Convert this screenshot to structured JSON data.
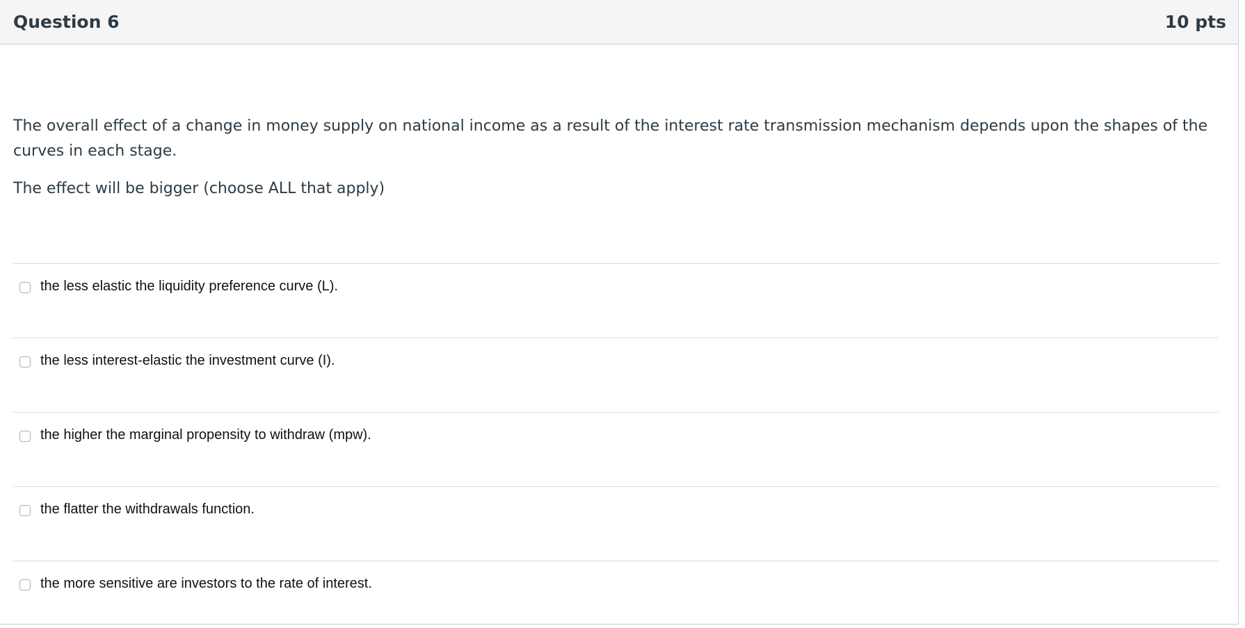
{
  "header": {
    "title": "Question 6",
    "points": "10 pts"
  },
  "prompt": {
    "paragraph1": "The overall effect of a change in money supply on national income as a result of the interest rate transmission mechanism depends upon the shapes of the curves in each stage.",
    "paragraph2": "The effect will be bigger (choose ALL that apply)"
  },
  "answers": [
    {
      "label": "the less elastic the liquidity preference curve (L).",
      "checked": false
    },
    {
      "label": "the less interest-elastic the investment curve (I).",
      "checked": false
    },
    {
      "label": "the higher the marginal propensity to withdraw (mpw).",
      "checked": false
    },
    {
      "label": "the flatter the withdrawals function.",
      "checked": false
    },
    {
      "label": "the more sensitive are investors to the rate of interest.",
      "checked": false
    }
  ],
  "colors": {
    "header_bg": "#f5f5f5",
    "text": "#2d3b45",
    "border": "#c7cdd1"
  }
}
